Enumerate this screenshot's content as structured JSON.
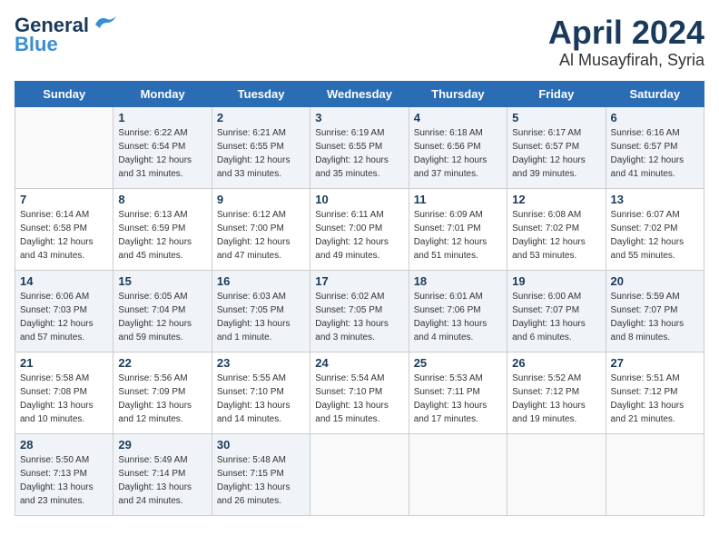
{
  "logo": {
    "line1": "General",
    "line2": "Blue"
  },
  "title": "April 2024",
  "subtitle": "Al Musayfirah, Syria",
  "days_of_week": [
    "Sunday",
    "Monday",
    "Tuesday",
    "Wednesday",
    "Thursday",
    "Friday",
    "Saturday"
  ],
  "weeks": [
    [
      {
        "day": "",
        "info": ""
      },
      {
        "day": "1",
        "info": "Sunrise: 6:22 AM\nSunset: 6:54 PM\nDaylight: 12 hours\nand 31 minutes."
      },
      {
        "day": "2",
        "info": "Sunrise: 6:21 AM\nSunset: 6:55 PM\nDaylight: 12 hours\nand 33 minutes."
      },
      {
        "day": "3",
        "info": "Sunrise: 6:19 AM\nSunset: 6:55 PM\nDaylight: 12 hours\nand 35 minutes."
      },
      {
        "day": "4",
        "info": "Sunrise: 6:18 AM\nSunset: 6:56 PM\nDaylight: 12 hours\nand 37 minutes."
      },
      {
        "day": "5",
        "info": "Sunrise: 6:17 AM\nSunset: 6:57 PM\nDaylight: 12 hours\nand 39 minutes."
      },
      {
        "day": "6",
        "info": "Sunrise: 6:16 AM\nSunset: 6:57 PM\nDaylight: 12 hours\nand 41 minutes."
      }
    ],
    [
      {
        "day": "7",
        "info": "Sunrise: 6:14 AM\nSunset: 6:58 PM\nDaylight: 12 hours\nand 43 minutes."
      },
      {
        "day": "8",
        "info": "Sunrise: 6:13 AM\nSunset: 6:59 PM\nDaylight: 12 hours\nand 45 minutes."
      },
      {
        "day": "9",
        "info": "Sunrise: 6:12 AM\nSunset: 7:00 PM\nDaylight: 12 hours\nand 47 minutes."
      },
      {
        "day": "10",
        "info": "Sunrise: 6:11 AM\nSunset: 7:00 PM\nDaylight: 12 hours\nand 49 minutes."
      },
      {
        "day": "11",
        "info": "Sunrise: 6:09 AM\nSunset: 7:01 PM\nDaylight: 12 hours\nand 51 minutes."
      },
      {
        "day": "12",
        "info": "Sunrise: 6:08 AM\nSunset: 7:02 PM\nDaylight: 12 hours\nand 53 minutes."
      },
      {
        "day": "13",
        "info": "Sunrise: 6:07 AM\nSunset: 7:02 PM\nDaylight: 12 hours\nand 55 minutes."
      }
    ],
    [
      {
        "day": "14",
        "info": "Sunrise: 6:06 AM\nSunset: 7:03 PM\nDaylight: 12 hours\nand 57 minutes."
      },
      {
        "day": "15",
        "info": "Sunrise: 6:05 AM\nSunset: 7:04 PM\nDaylight: 12 hours\nand 59 minutes."
      },
      {
        "day": "16",
        "info": "Sunrise: 6:03 AM\nSunset: 7:05 PM\nDaylight: 13 hours\nand 1 minute."
      },
      {
        "day": "17",
        "info": "Sunrise: 6:02 AM\nSunset: 7:05 PM\nDaylight: 13 hours\nand 3 minutes."
      },
      {
        "day": "18",
        "info": "Sunrise: 6:01 AM\nSunset: 7:06 PM\nDaylight: 13 hours\nand 4 minutes."
      },
      {
        "day": "19",
        "info": "Sunrise: 6:00 AM\nSunset: 7:07 PM\nDaylight: 13 hours\nand 6 minutes."
      },
      {
        "day": "20",
        "info": "Sunrise: 5:59 AM\nSunset: 7:07 PM\nDaylight: 13 hours\nand 8 minutes."
      }
    ],
    [
      {
        "day": "21",
        "info": "Sunrise: 5:58 AM\nSunset: 7:08 PM\nDaylight: 13 hours\nand 10 minutes."
      },
      {
        "day": "22",
        "info": "Sunrise: 5:56 AM\nSunset: 7:09 PM\nDaylight: 13 hours\nand 12 minutes."
      },
      {
        "day": "23",
        "info": "Sunrise: 5:55 AM\nSunset: 7:10 PM\nDaylight: 13 hours\nand 14 minutes."
      },
      {
        "day": "24",
        "info": "Sunrise: 5:54 AM\nSunset: 7:10 PM\nDaylight: 13 hours\nand 15 minutes."
      },
      {
        "day": "25",
        "info": "Sunrise: 5:53 AM\nSunset: 7:11 PM\nDaylight: 13 hours\nand 17 minutes."
      },
      {
        "day": "26",
        "info": "Sunrise: 5:52 AM\nSunset: 7:12 PM\nDaylight: 13 hours\nand 19 minutes."
      },
      {
        "day": "27",
        "info": "Sunrise: 5:51 AM\nSunset: 7:12 PM\nDaylight: 13 hours\nand 21 minutes."
      }
    ],
    [
      {
        "day": "28",
        "info": "Sunrise: 5:50 AM\nSunset: 7:13 PM\nDaylight: 13 hours\nand 23 minutes."
      },
      {
        "day": "29",
        "info": "Sunrise: 5:49 AM\nSunset: 7:14 PM\nDaylight: 13 hours\nand 24 minutes."
      },
      {
        "day": "30",
        "info": "Sunrise: 5:48 AM\nSunset: 7:15 PM\nDaylight: 13 hours\nand 26 minutes."
      },
      {
        "day": "",
        "info": ""
      },
      {
        "day": "",
        "info": ""
      },
      {
        "day": "",
        "info": ""
      },
      {
        "day": "",
        "info": ""
      }
    ]
  ]
}
